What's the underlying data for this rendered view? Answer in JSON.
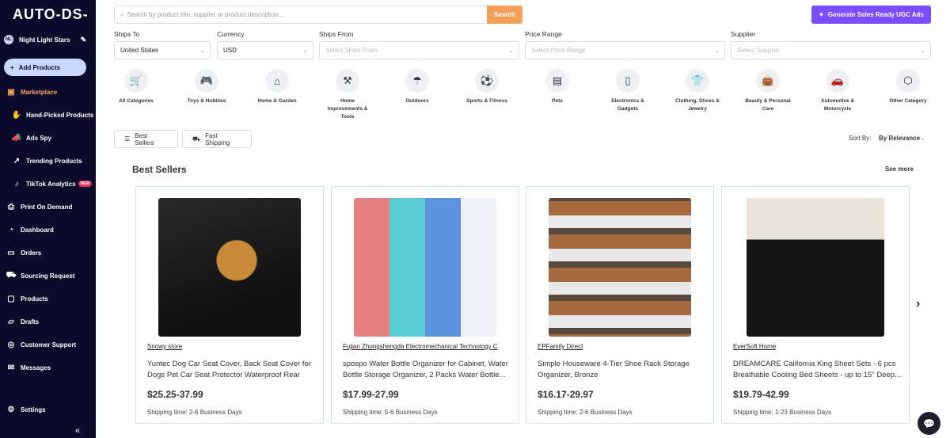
{
  "app": {
    "logo_text": "AUTO-DS-"
  },
  "user": {
    "initials": "NL",
    "name": "Night Light Stars"
  },
  "sidebar": {
    "add_products": "Add Products",
    "items": [
      {
        "label": "Marketplace",
        "icon": "store-icon",
        "glyph": "▣"
      },
      {
        "label": "Hand-Picked Products",
        "icon": "hand-icon",
        "glyph": "✋"
      },
      {
        "label": "Ads Spy",
        "icon": "megaphone-icon",
        "glyph": "📣"
      },
      {
        "label": "Trending Products",
        "icon": "trend-icon",
        "glyph": "↗"
      },
      {
        "label": "TikTok Analytics",
        "icon": "tiktok-icon",
        "glyph": "♪",
        "badge": "NEW"
      },
      {
        "label": "Print On Demand",
        "icon": "printer-icon",
        "glyph": "⎙"
      },
      {
        "label": "Dashboard",
        "icon": "gauge-icon",
        "glyph": "◔"
      },
      {
        "label": "Orders",
        "icon": "orders-icon",
        "glyph": "▭"
      },
      {
        "label": "Sourcing Request",
        "icon": "truck-icon",
        "glyph": "⛟"
      },
      {
        "label": "Products",
        "icon": "box-icon",
        "glyph": "▢"
      },
      {
        "label": "Drafts",
        "icon": "folder-icon",
        "glyph": "▱"
      },
      {
        "label": "Customer Support",
        "icon": "support-icon",
        "glyph": "◎"
      },
      {
        "label": "Messages",
        "icon": "mail-icon",
        "glyph": "✉"
      },
      {
        "label": "Settings",
        "icon": "gear-icon",
        "glyph": "⚙"
      }
    ],
    "collapse_glyph": "«"
  },
  "search": {
    "placeholder": "Search by product title, supplier or product description...",
    "button": "Search"
  },
  "ugc_button": "Generate Sales Ready UGC Ads",
  "filters": {
    "ships_to": {
      "label": "Ships To",
      "value": "United States"
    },
    "currency": {
      "label": "Currency",
      "value": "USD"
    },
    "ships_from": {
      "label": "Ships From",
      "placeholder": "Select Ships From"
    },
    "price_range": {
      "label": "Price Range",
      "placeholder": "Select Price Range"
    },
    "supplier": {
      "label": "Supplier",
      "placeholder": "Select Supplier"
    }
  },
  "categories": [
    {
      "label": "All Categories",
      "icon": "cart-icon",
      "glyph": "🛒"
    },
    {
      "label": "Toys & Hobbies",
      "icon": "gamepad-icon",
      "glyph": "🎮"
    },
    {
      "label": "Home & Garden",
      "icon": "house-icon",
      "glyph": "⌂"
    },
    {
      "label": "Home Improvements & Tools",
      "icon": "tools-icon",
      "glyph": "⚒"
    },
    {
      "label": "Outdoors",
      "icon": "umbrella-icon",
      "glyph": "☂"
    },
    {
      "label": "Sports & Fitness",
      "icon": "ball-icon",
      "glyph": "⚽"
    },
    {
      "label": "Pets",
      "icon": "pet-icon",
      "glyph": "▤"
    },
    {
      "label": "Electronics & Gadgets",
      "icon": "phone-icon",
      "glyph": "▯"
    },
    {
      "label": "Clothing, Shoes & Jewelry",
      "icon": "shirt-icon",
      "glyph": "👕"
    },
    {
      "label": "Beauty & Personal Care",
      "icon": "bag-icon",
      "glyph": "👜"
    },
    {
      "label": "Automotive & Motorcycle",
      "icon": "car-icon",
      "glyph": "🚗"
    },
    {
      "label": "Other Category",
      "icon": "cube-icon",
      "glyph": "⬡"
    }
  ],
  "pills": {
    "best_sellers": "Best Sellers",
    "fast_shipping": "Fast Shipping"
  },
  "sort": {
    "label": "Sort By:",
    "value": "By Relevance"
  },
  "section": {
    "title": "Best Sellers",
    "see_more": "See more"
  },
  "products": [
    {
      "supplier": "Snowy store",
      "title": "Yuntec Dog Car Seat Cover, Back Seat Cover for Dogs Pet Car Seat Protector Waterproof Rear Se...",
      "price": "$25.25-37.99",
      "shipping": "Shipping time: 2-6 Business Days",
      "image_colors": [
        "#1b1b1b",
        "#c98a3a"
      ]
    },
    {
      "supplier": "Fujian Zhongshengda Electromechanical Technology C",
      "title": "spospo Water Bottle Organizer for Cabinet, Water Bottle Storage Organizer, 2 Packs Water Bottle...",
      "price": "$17.99-27.99",
      "shipping": "Shipping time: 5-6 Business Days",
      "image_colors": [
        "#e06a6a",
        "#3ac3c9",
        "#3f7ed8"
      ]
    },
    {
      "supplier": "EPFamily Direct",
      "title": "Simple Houseware 4-Tier Shoe Rack Storage Organizer, Bronze",
      "price": "$16.17-29.97",
      "shipping": "Shipping time: 2-6 Business Days",
      "image_colors": [
        "#5a4a3e",
        "#a86a40",
        "#e8e8e8"
      ]
    },
    {
      "supplier": "EverSoft Home",
      "title": "DREAMCARE California King Sheet Sets - 6 pcs Breathable Cooling Bed Sheets - up to 15\" Deep...",
      "price": "$19.79-42.99",
      "shipping": "Shipping time: 1-23 Business Days",
      "image_colors": [
        "#151515",
        "#e9e2d8"
      ]
    }
  ]
}
